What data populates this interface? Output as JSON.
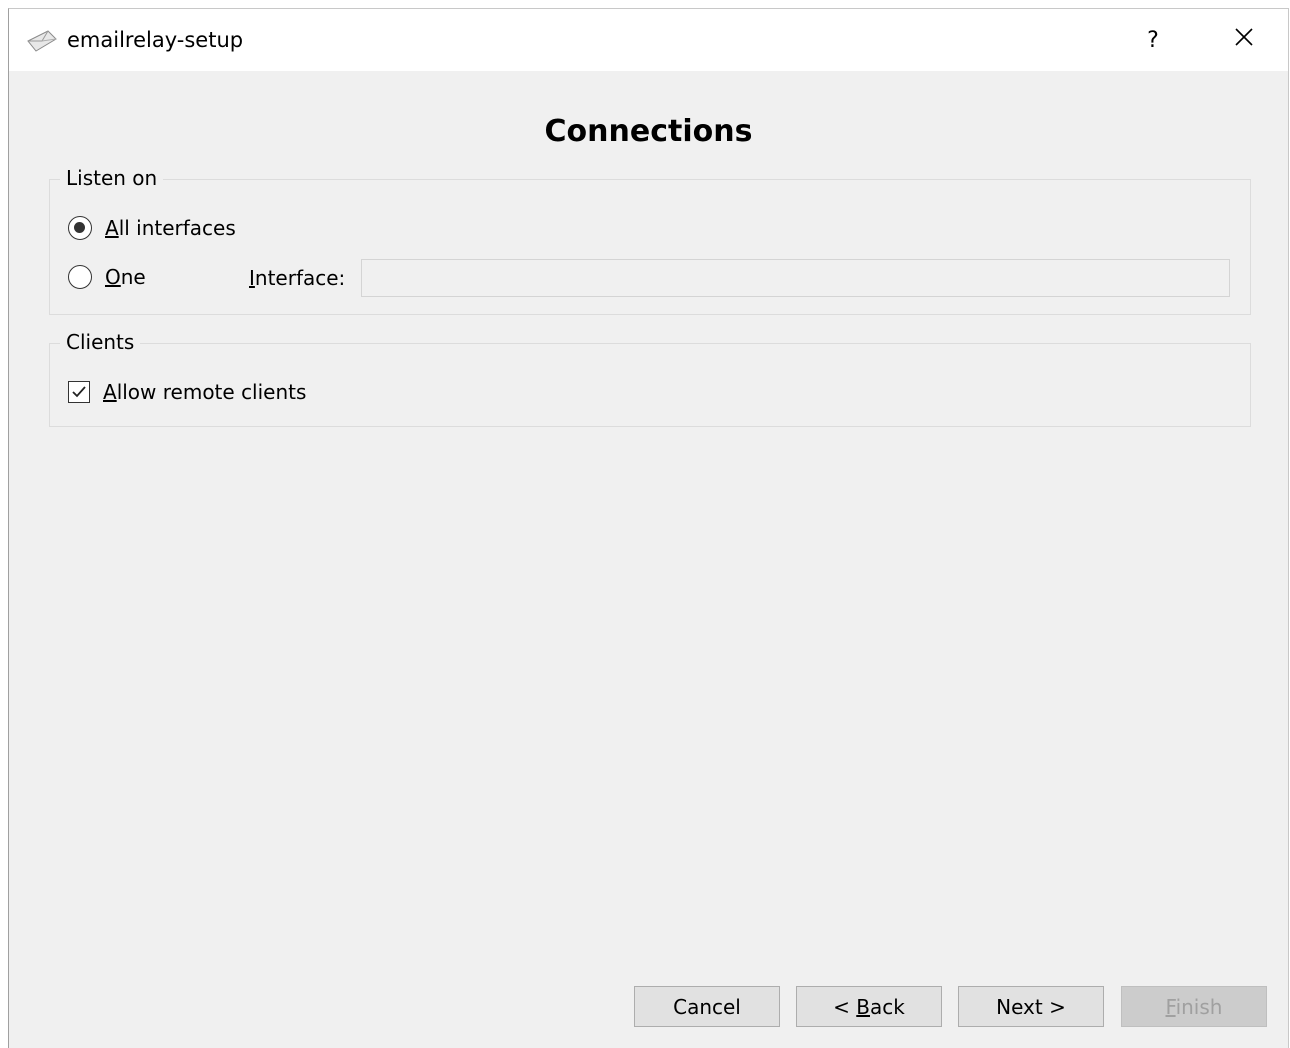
{
  "window": {
    "title": "emailrelay-setup",
    "help_label": "?",
    "close_label": "✕"
  },
  "page": {
    "title": "Connections"
  },
  "listen_on": {
    "group_title": "Listen on",
    "all_interfaces": {
      "label_mnemonic": "A",
      "label_rest": "ll interfaces",
      "checked": true
    },
    "one": {
      "label_mnemonic": "O",
      "label_rest": "ne",
      "checked": false
    },
    "interface_label_mnemonic": "I",
    "interface_label_rest": "nterface:",
    "interface_value": ""
  },
  "clients": {
    "group_title": "Clients",
    "allow_remote": {
      "label_mnemonic": "A",
      "label_rest": "llow remote clients",
      "checked": true
    }
  },
  "buttons": {
    "cancel": "Cancel",
    "back_prefix": "< ",
    "back_mnemonic": "B",
    "back_rest": "ack",
    "next": "Next >",
    "finish_mnemonic": "F",
    "finish_rest": "inish"
  }
}
